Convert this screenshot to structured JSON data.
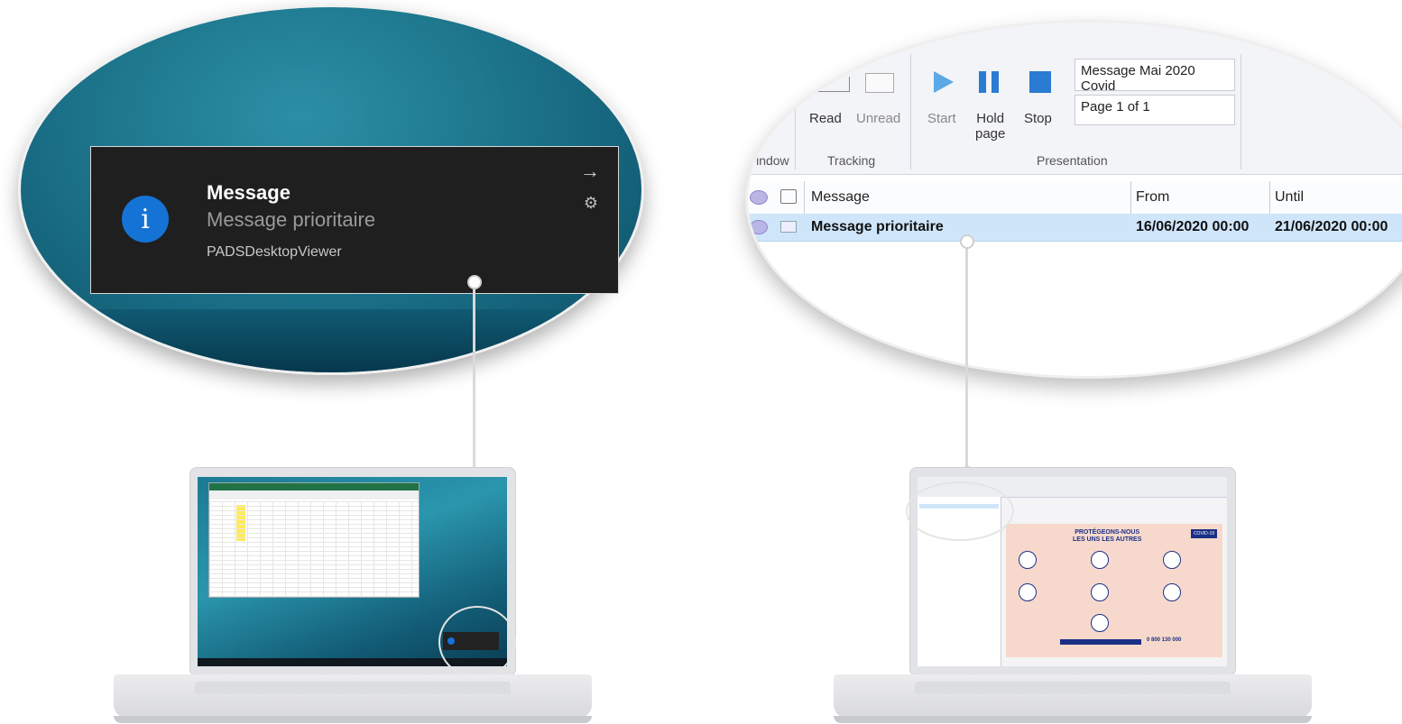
{
  "notification": {
    "title": "Message",
    "body": "Message prioritaire",
    "app_name": "PADSDesktopViewer",
    "info_glyph": "i",
    "arrow_glyph": "→",
    "gear_glyph": "⚙"
  },
  "ribbon": {
    "groups": [
      {
        "label": "Vindow"
      },
      {
        "label": "Tracking"
      },
      {
        "label": "Presentation"
      }
    ],
    "buttons": {
      "read": "Read",
      "unread": "Unread",
      "start": "Start",
      "hold_page_line1": "Hold",
      "hold_page_line2": "page",
      "stop": "Stop"
    },
    "message_name_value": "Message Mai 2020 Covid",
    "page_indicator": "Page 1 of 1"
  },
  "message_grid": {
    "columns": {
      "message": "Message",
      "from": "From",
      "until": "Until"
    },
    "rows": [
      {
        "message": "Message prioritaire",
        "from": "16/06/2020 00:00",
        "until": "21/06/2020 00:00"
      }
    ]
  },
  "poster": {
    "headline_line1": "PROTÉGEONS-NOUS",
    "headline_line2": "LES UNS LES AUTRES",
    "badge": "COVID-19",
    "phone": "0 800 130 000"
  },
  "colors": {
    "toast_bg": "#1f1f1f",
    "info_accent": "#1673d6",
    "selected_row": "#cfe5fa",
    "ribbon_blue": "#2a7bd1"
  }
}
